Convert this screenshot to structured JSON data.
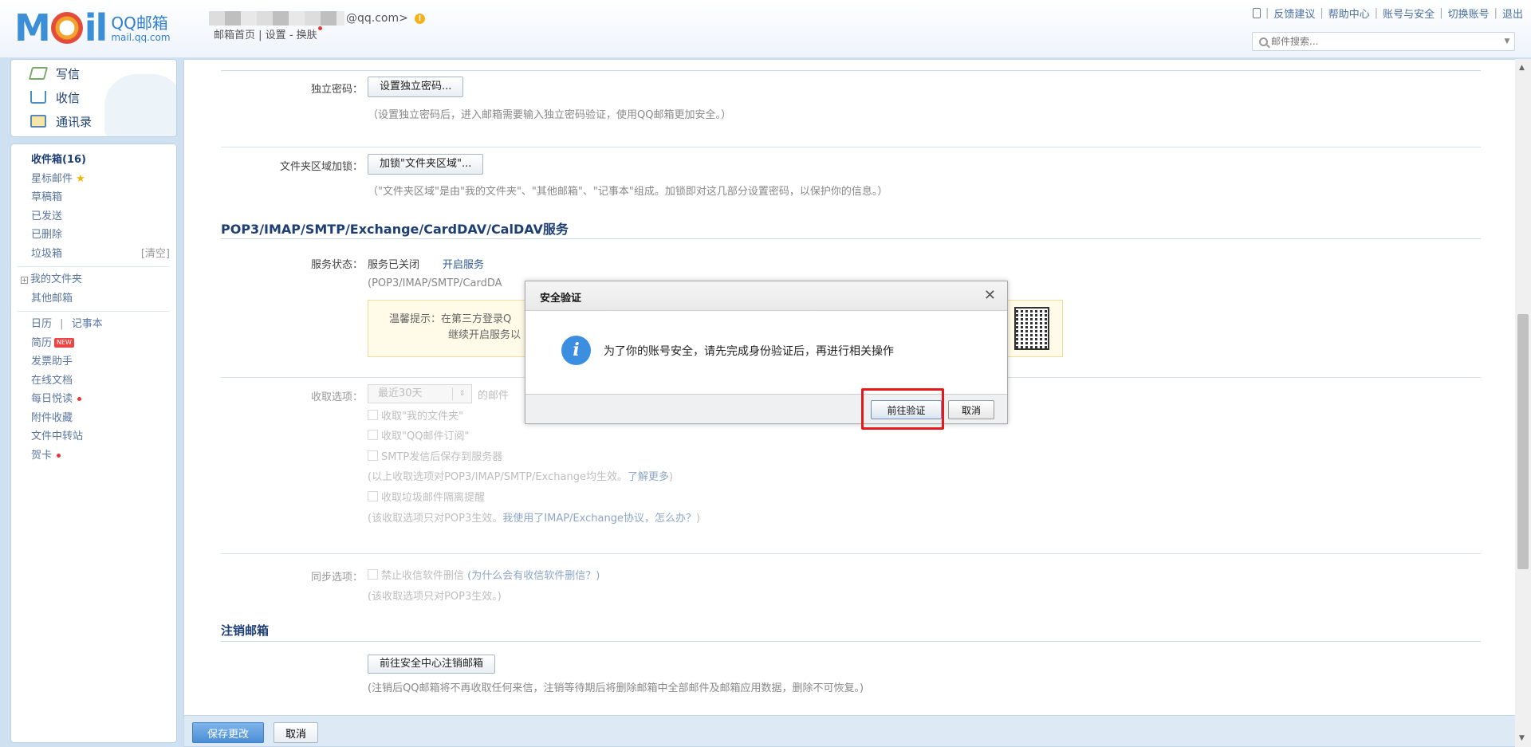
{
  "header": {
    "logo_mark": "M",
    "logo_tail": "il",
    "logo_cn": "QQ邮箱",
    "logo_en": "mail.qq.com",
    "account_suffix": "@qq.com>",
    "links": [
      "邮箱首页",
      "设置",
      "换肤"
    ],
    "top_links": [
      "反馈建议",
      "帮助中心",
      "账号与安全",
      "切换账号",
      "退出"
    ],
    "search_placeholder": "邮件搜索..."
  },
  "sidebar": {
    "actions": [
      {
        "label": "写信",
        "icon": "write-icon"
      },
      {
        "label": "收信",
        "icon": "inbox-download-icon"
      },
      {
        "label": "通讯录",
        "icon": "address-book-icon"
      }
    ],
    "folders": [
      {
        "label": "收件箱(16)"
      },
      {
        "label": "星标邮件"
      },
      {
        "label": "草稿箱"
      },
      {
        "label": "已发送"
      },
      {
        "label": "已删除"
      },
      {
        "label": "垃圾箱",
        "action": "[清空]"
      }
    ],
    "groups": [
      {
        "label": "我的文件夹"
      },
      {
        "label": "其他邮箱"
      }
    ],
    "apps": [
      {
        "label": "日历",
        "label2": "记事本"
      },
      {
        "label": "简历",
        "badge": "NEW"
      },
      {
        "label": "发票助手"
      },
      {
        "label": "在线文档"
      },
      {
        "label": "每日悦读"
      },
      {
        "label": "附件收藏"
      },
      {
        "label": "文件中转站"
      },
      {
        "label": "贺卡"
      }
    ]
  },
  "settings": {
    "standalone_password": {
      "label": "独立密码：",
      "button": "设置独立密码...",
      "hint": "（设置独立密码后，进入邮箱需要输入独立密码验证，使用QQ邮箱更加安全。）"
    },
    "folder_lock": {
      "label": "文件夹区域加锁：",
      "button": "加锁\"文件夹区域\"...",
      "hint": "（\"文件夹区域\"是由\"我的文件夹\"、\"其他邮箱\"、\"记事本\"组成。加锁即对这几部分设置密码，以保护你的信息。）"
    },
    "pop_section_title": "POP3/IMAP/SMTP/Exchange/CardDAV/CalDAV服务",
    "service_status": {
      "label": "服务状态：",
      "value": "服务已关闭",
      "action": "开启服务",
      "hint": "(POP3/IMAP/SMTP/CardDA"
    },
    "tip": {
      "line1": "温馨提示：在第三方登录Q",
      "line2": "继续开启服务以"
    },
    "receive_options": {
      "label": "收取选项：",
      "select_value": "最近30天",
      "select_suffix": "的邮件",
      "checks": [
        "收取\"我的文件夹\"",
        "收取\"QQ邮件订阅\"",
        "SMTP发信后保存到服务器"
      ],
      "note1": "(以上收取选项对POP3/IMAP/SMTP/Exchange均生效。",
      "note1_link": "了解更多",
      "note1_end": ")",
      "spam_check": "收取垃圾邮件隔离提醒",
      "note2": "(该收取选项只对POP3生效。",
      "note2_link": "我使用了IMAP/Exchange协议，怎么办？",
      "note2_end": ")"
    },
    "sync_options": {
      "label": "同步选项：",
      "check": "禁止收信软件删信",
      "check_link": "(为什么会有收信软件删信？)",
      "note": "(该收取选项只对POP3生效。)"
    },
    "cancel_section_title": "注销邮箱",
    "cancel_account": {
      "button": "前往安全中心注销邮箱",
      "hint": "(注销后QQ邮箱将不再收取任何来信，注销等待期后将删除邮箱中全部邮件及邮箱应用数据，删除不可恢复。)"
    },
    "save_button": "保存更改",
    "cancel_button": "取消"
  },
  "dialog": {
    "title": "安全验证",
    "message": "为了你的账号安全，请先完成身份验证后，再进行相关操作",
    "confirm": "前往验证",
    "cancel": "取消"
  },
  "colors": {
    "accent": "#3c8ee0",
    "highlight": "#e3191b",
    "section_title": "#1d3f74"
  }
}
